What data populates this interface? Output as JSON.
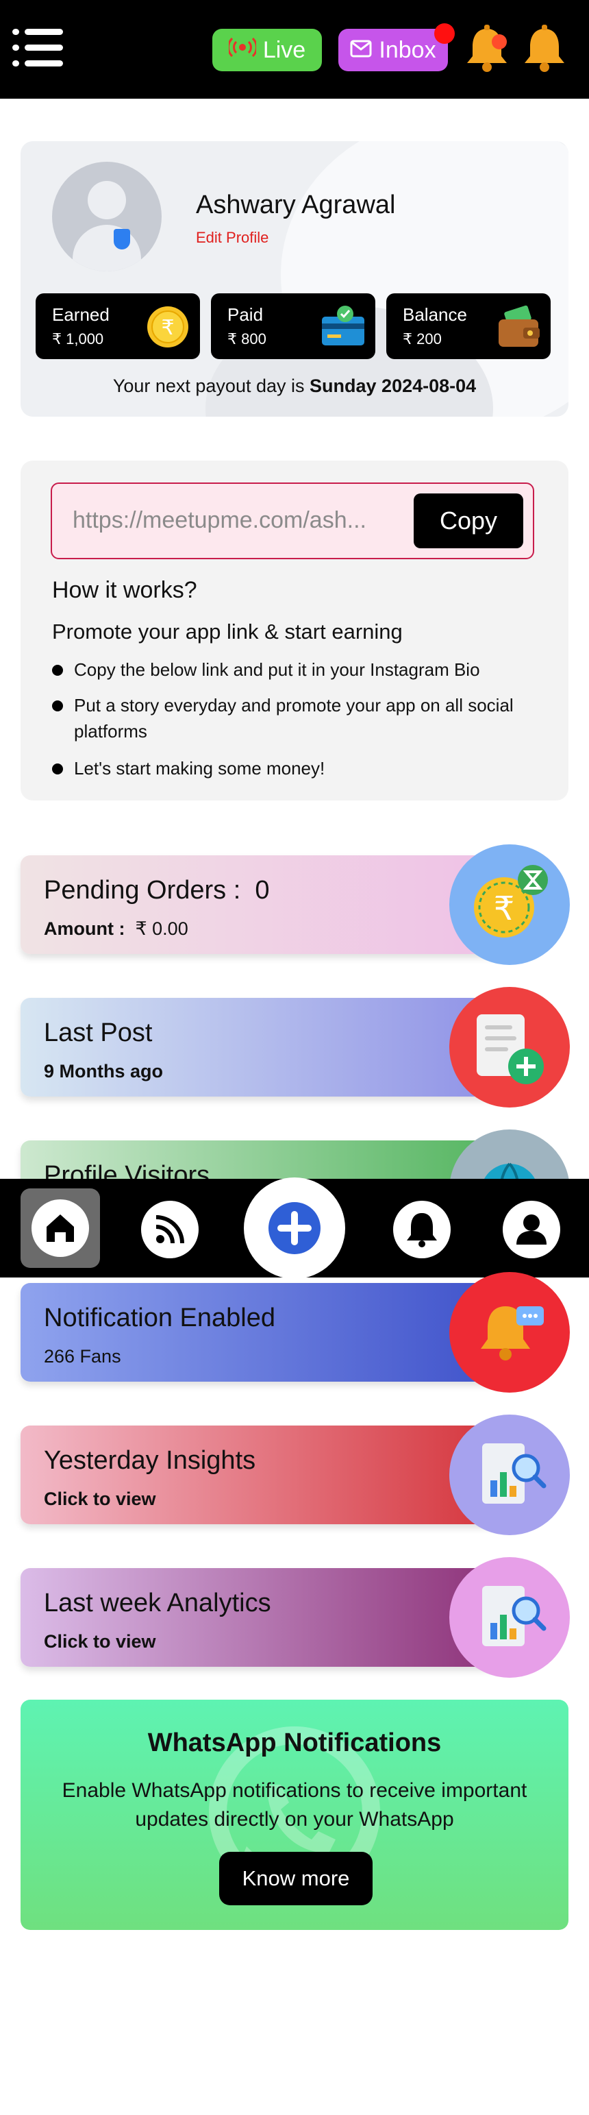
{
  "header": {
    "live_label": "Live",
    "inbox_label": "Inbox",
    "icons": [
      "menu-icon",
      "live-broadcast-icon",
      "mail-icon",
      "bell-icon",
      "bell-icon"
    ]
  },
  "profile": {
    "name": "Ashwary Agrawal",
    "edit_label": "Edit Profile",
    "stats": [
      {
        "label": "Earned",
        "value": "₹ 1,000",
        "icon": "rupee-coin-icon"
      },
      {
        "label": "Paid",
        "value": "₹ 800",
        "icon": "card-check-icon"
      },
      {
        "label": "Balance",
        "value": "₹ 200",
        "icon": "wallet-icon"
      }
    ],
    "payout_prefix": "Your next payout day is",
    "payout_date": "Sunday 2024-08-04"
  },
  "promo": {
    "link": "https://meetupme.com/ash...",
    "copy_label": "Copy",
    "how_title": "How it works?",
    "how_subtitle": "Promote your app link & start earning",
    "steps": [
      "Copy the below link and put it in your Instagram Bio",
      "Put a story everyday and promote your app on all social platforms",
      "Let's start making some money!"
    ]
  },
  "cards": {
    "pending": {
      "title": "Pending Orders :",
      "count": "0",
      "amount_label": "Amount :",
      "amount_value": "₹ 0.00"
    },
    "last_post": {
      "title": "Last Post",
      "subtitle": "9 Months ago"
    },
    "profile_visitors": {
      "title": "Profile Visitors"
    },
    "notification": {
      "title": "Notification Enabled",
      "subtitle": "266 Fans"
    },
    "yesterday": {
      "title": "Yesterday Insights",
      "subtitle": "Click to view"
    },
    "last_week": {
      "title": "Last week Analytics",
      "subtitle": "Click to view"
    }
  },
  "bottom_nav": {
    "items": [
      "home-icon",
      "feed-icon",
      "add-icon",
      "notifications-icon",
      "profile-icon"
    ]
  },
  "whatsapp": {
    "title": "WhatsApp Notifications",
    "description": "Enable WhatsApp notifications to receive important updates directly on your WhatsApp",
    "button_label": "Know more"
  },
  "colors": {
    "live": "#5ad24c",
    "inbox": "#c655ea",
    "edit_link": "#e0201e",
    "notification_dot": "#ff1010",
    "link_box_border": "#c81c4b"
  }
}
